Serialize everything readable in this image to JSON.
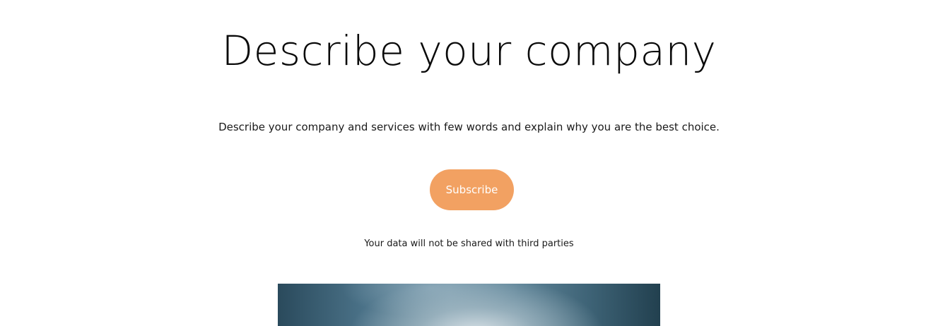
{
  "hero": {
    "title": "Describe your company",
    "subtitle": "Describe your company and services with few words and explain why you are the best choice.",
    "subscribe_label": "Subscribe",
    "privacy_note": "Your data will not be shared with third parties"
  },
  "colors": {
    "accent": "#f2a162",
    "text": "#0a0a0a",
    "background": "#ffffff"
  }
}
